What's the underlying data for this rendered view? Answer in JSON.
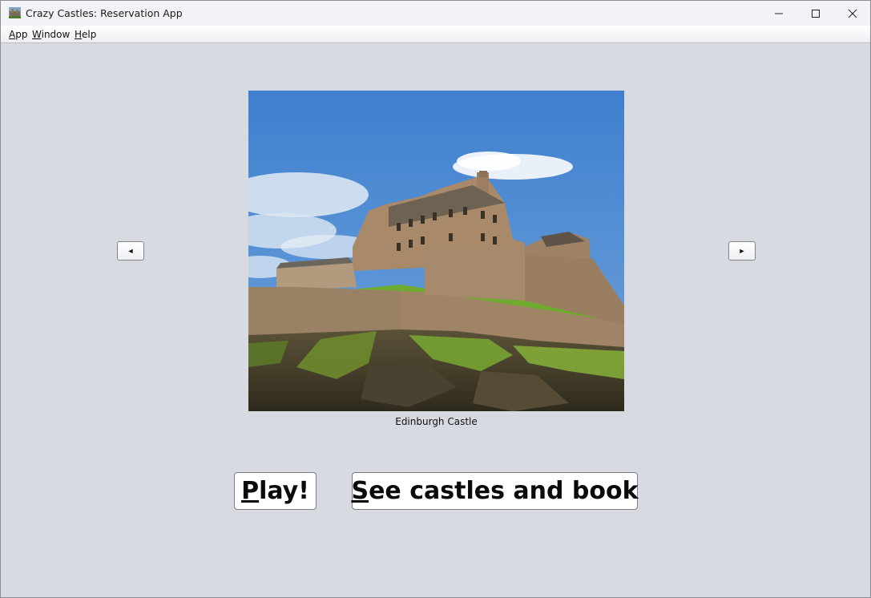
{
  "window": {
    "title": "Crazy Castles: Reservation App",
    "controls": {
      "minimize": "minimize",
      "maximize": "maximize",
      "close": "close"
    }
  },
  "menubar": {
    "items": [
      {
        "mnemonic": "A",
        "rest": "pp"
      },
      {
        "mnemonic": "W",
        "rest": "indow"
      },
      {
        "mnemonic": "H",
        "rest": "elp"
      }
    ]
  },
  "carousel": {
    "prev_label": "◄",
    "next_label": "►",
    "caption": "Edinburgh Castle"
  },
  "actions": {
    "play": {
      "mnemonic": "P",
      "rest": "lay!"
    },
    "see_castles": {
      "mnemonic": "S",
      "rest": "ee castles and book"
    }
  },
  "colors": {
    "background": "#d8dae1",
    "sky": "#4a86d2",
    "stone": "#a08466",
    "grass": "#6aa32c"
  }
}
